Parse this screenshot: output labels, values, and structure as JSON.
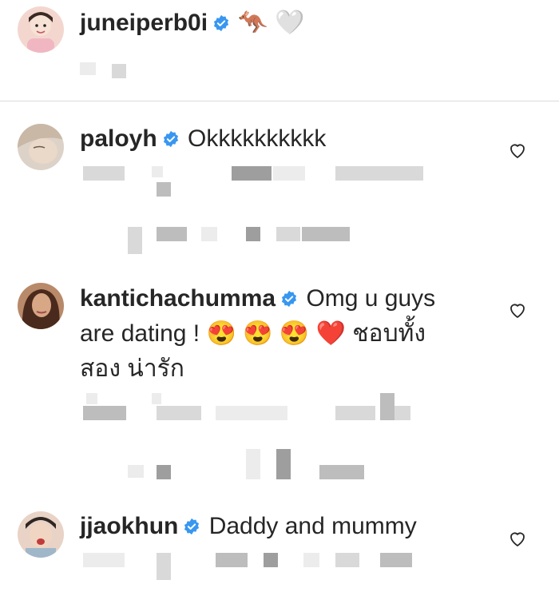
{
  "caption": {
    "username": "juneiperb0i",
    "text": "🦘 🤍",
    "avatar_bg": "#f3d7cf"
  },
  "comments": [
    {
      "username": "paloyh",
      "text": "Okkkkkkkkkk",
      "avatar_bg": "#dcd2c8"
    },
    {
      "username": "kantichachumma",
      "text": "Omg u guys are dating ! 😍😍😍 ❤️ ชอบทั้งสอง น่ารัก",
      "text_line1": "Omg u guys",
      "text_line2": "are dating ! 😍 😍 😍  ❤️  ชอบทั้ง",
      "text_line3": "สอง น่ารัก",
      "avatar_bg": "#8a5a3c"
    },
    {
      "username": "jjaokhun",
      "text": "Daddy and mummy",
      "avatar_bg": "#e8d3c6"
    }
  ],
  "colors": {
    "verified": "#3897f0",
    "divider": "#dbdbdb",
    "text": "#262626",
    "heart_outline": "#262626"
  },
  "icons": {
    "verified": "verified-badge-icon",
    "like": "heart-outline-icon"
  }
}
